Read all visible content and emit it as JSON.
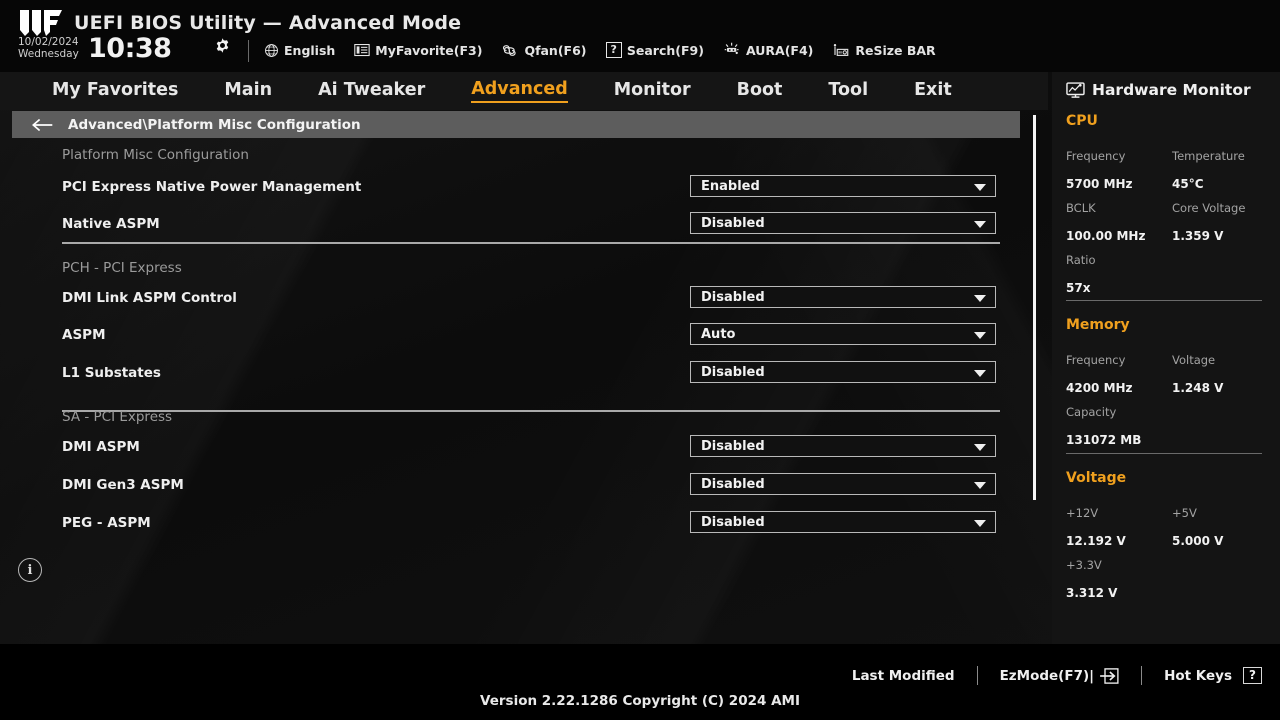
{
  "header": {
    "logo": "tuf-logo",
    "title": "UEFI BIOS Utility — Advanced Mode",
    "date": "10/02/2024",
    "weekday": "Wednesday",
    "time": "10:38",
    "gear_icon": "gear-icon",
    "items": [
      {
        "icon": "globe-icon",
        "label": "English"
      },
      {
        "icon": "myfavorite-icon",
        "label": "MyFavorite(F3)"
      },
      {
        "icon": "qfan-icon",
        "label": "Qfan(F6)"
      },
      {
        "icon": "help-box-icon",
        "label": "Search(F9)"
      },
      {
        "icon": "aura-icon",
        "label": "AURA(F4)"
      },
      {
        "icon": "resize-bar-icon",
        "label": "ReSize BAR"
      }
    ]
  },
  "tabs": [
    {
      "label": "My Favorites",
      "active": false
    },
    {
      "label": "Main",
      "active": false
    },
    {
      "label": "Ai Tweaker",
      "active": false
    },
    {
      "label": "Advanced",
      "active": true
    },
    {
      "label": "Monitor",
      "active": false
    },
    {
      "label": "Boot",
      "active": false
    },
    {
      "label": "Tool",
      "active": false
    },
    {
      "label": "Exit",
      "active": false
    }
  ],
  "breadcrumb": {
    "back_icon": "back-arrow-icon",
    "path": "Advanced\\Platform Misc Configuration"
  },
  "settings": {
    "info_icon_label": "i",
    "rows": [
      {
        "kind": "group",
        "label": "Platform Misc Configuration"
      },
      {
        "kind": "setting",
        "label": "PCI Express Native Power Management",
        "value": "Enabled"
      },
      {
        "kind": "setting",
        "label": "Native ASPM",
        "value": "Disabled"
      },
      {
        "kind": "divider"
      },
      {
        "kind": "group",
        "label": "PCH - PCI Express"
      },
      {
        "kind": "setting",
        "label": "DMI Link ASPM Control",
        "value": "Disabled"
      },
      {
        "kind": "setting",
        "label": "ASPM",
        "value": "Auto"
      },
      {
        "kind": "setting",
        "label": "L1 Substates",
        "value": "Disabled"
      },
      {
        "kind": "divider"
      },
      {
        "kind": "group",
        "label": "SA - PCI Express"
      },
      {
        "kind": "setting",
        "label": "DMI ASPM",
        "value": "Disabled"
      },
      {
        "kind": "setting",
        "label": "DMI Gen3 ASPM",
        "value": "Disabled"
      },
      {
        "kind": "setting",
        "label": "PEG - ASPM",
        "value": "Disabled"
      }
    ]
  },
  "hardware_monitor": {
    "icon": "monitor-icon",
    "title": "Hardware Monitor",
    "sections": [
      {
        "name": "CPU",
        "pairs": [
          {
            "key": "Frequency",
            "value": "5700 MHz"
          },
          {
            "key": "Temperature",
            "value": "45°C"
          },
          {
            "key": "BCLK",
            "value": "100.00 MHz"
          },
          {
            "key": "Core Voltage",
            "value": "1.359 V"
          },
          {
            "key": "Ratio",
            "value": "57x"
          }
        ]
      },
      {
        "name": "Memory",
        "pairs": [
          {
            "key": "Frequency",
            "value": "4200 MHz"
          },
          {
            "key": "Voltage",
            "value": "1.248 V"
          },
          {
            "key": "Capacity",
            "value": "131072 MB"
          }
        ]
      },
      {
        "name": "Voltage",
        "pairs": [
          {
            "key": "+12V",
            "value": "12.192 V"
          },
          {
            "key": "+5V",
            "value": "5.000 V"
          },
          {
            "key": "+3.3V",
            "value": "3.312 V"
          }
        ]
      }
    ]
  },
  "footer": {
    "last_modified": "Last Modified",
    "ezmode": "EzMode(F7)|",
    "hotkeys": "Hot Keys",
    "hotkeys_badge": "?",
    "version": "Version 2.22.1286 Copyright (C) 2024 AMI"
  },
  "colors": {
    "accent": "#f0a01e",
    "panel": "#141414",
    "breadcrumb_bg": "#5d5d5d",
    "text": "#f0f0f0",
    "muted": "#a3a3a3"
  }
}
